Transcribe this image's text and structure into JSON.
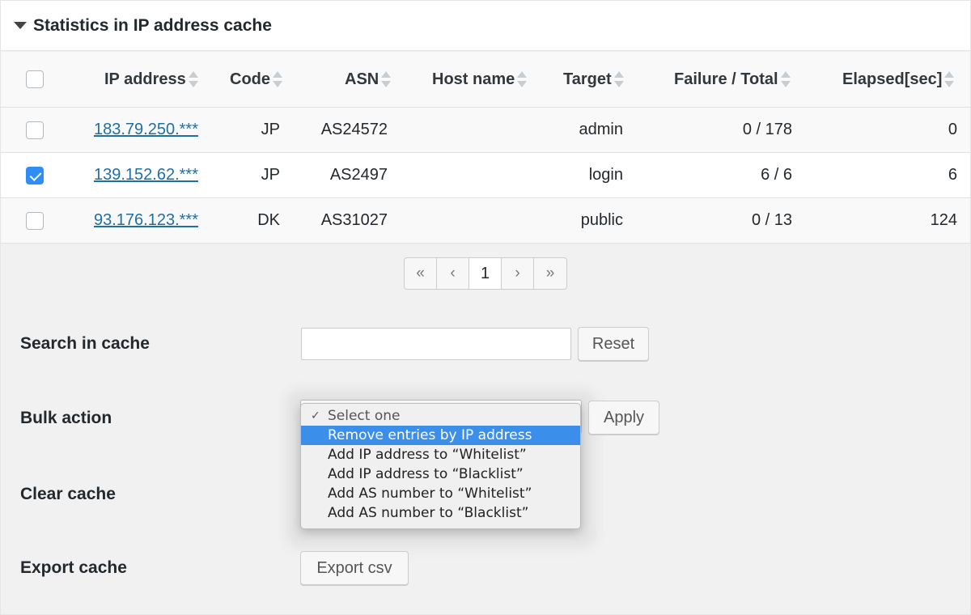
{
  "panel": {
    "title": "Statistics in IP address cache"
  },
  "table": {
    "columns": [
      "IP address",
      "Code",
      "ASN",
      "Host name",
      "Target",
      "Failure / Total",
      "Elapsed[sec]"
    ],
    "rows": [
      {
        "ip": "183.79.250.***",
        "code": "JP",
        "asn": "AS24572",
        "host": "",
        "target": "admin",
        "failure_total": "0 / 178",
        "elapsed": "0",
        "checked": false
      },
      {
        "ip": "139.152.62.***",
        "code": "JP",
        "asn": "AS2497",
        "host": "",
        "target": "login",
        "failure_total": "6 / 6",
        "elapsed": "6",
        "checked": true
      },
      {
        "ip": "93.176.123.***",
        "code": "DK",
        "asn": "AS31027",
        "host": "",
        "target": "public",
        "failure_total": "0 / 13",
        "elapsed": "124",
        "checked": false
      }
    ]
  },
  "pager": {
    "first": "«",
    "prev": "‹",
    "current": "1",
    "next": "›",
    "last": "»"
  },
  "form": {
    "search_label": "Search in cache",
    "search_value": "",
    "reset_label": "Reset",
    "bulk_label": "Bulk action",
    "apply_label": "Apply",
    "clear_label": "Clear cache",
    "export_label": "Export cache",
    "export_button": "Export csv"
  },
  "bulk_menu": {
    "check": "✓",
    "options": [
      "Select one",
      "Remove entries by IP address",
      "Add IP address to “Whitelist”",
      "Add IP address to “Blacklist”",
      "Add AS number to “Whitelist”",
      "Add AS number to “Blacklist”"
    ]
  },
  "colors": {
    "accent": "#2f8ef5",
    "link": "#1e6fa6",
    "highlight": "#3b8eea"
  }
}
